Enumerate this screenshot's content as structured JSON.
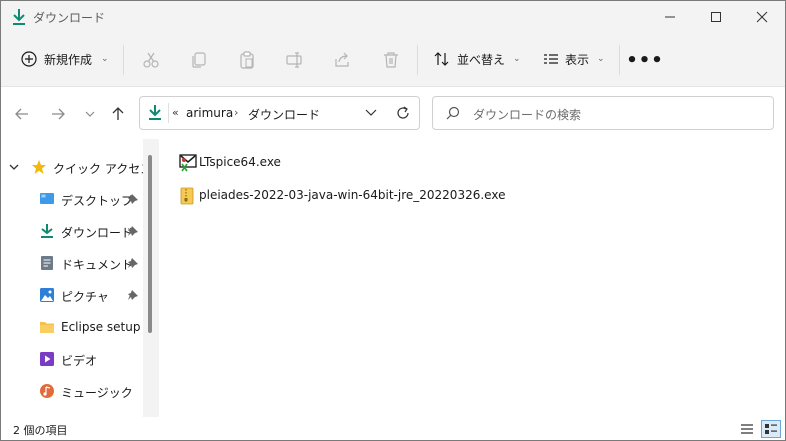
{
  "window": {
    "title": "ダウンロード",
    "title_icon": "download-arrow-icon",
    "controls": [
      "minimize-icon",
      "maximize-icon",
      "close-icon"
    ]
  },
  "toolbar": {
    "new_label": "新規作成",
    "actions": [
      "cut-icon",
      "copy-icon",
      "paste-icon",
      "rename-icon",
      "share-icon",
      "delete-icon"
    ],
    "sort_label": "並べ替え",
    "view_label": "表示",
    "more_label": "•••"
  },
  "nav": {
    "overflow": "«",
    "path": [
      "arimura",
      "ダウンロード"
    ],
    "path_separator": "›",
    "search_placeholder": "ダウンロードの検索"
  },
  "sidebar": {
    "quick_access_label": "クイック アクセス",
    "items": [
      {
        "label": "デスクトップ",
        "icon": "desktop-icon",
        "pinned": true
      },
      {
        "label": "ダウンロード",
        "icon": "download-icon",
        "pinned": true
      },
      {
        "label": "ドキュメント",
        "icon": "documents-icon",
        "pinned": true
      },
      {
        "label": "ピクチャ",
        "icon": "pictures-icon",
        "pinned": true
      },
      {
        "label": "Eclipse setup",
        "icon": "folder-icon",
        "pinned": false
      },
      {
        "label": "ビデオ",
        "icon": "videos-icon",
        "pinned": false
      },
      {
        "label": "ミュージック",
        "icon": "music-icon",
        "pinned": false
      }
    ]
  },
  "files": [
    {
      "name": "LTspice64.exe",
      "icon": "ltspice-exe-icon"
    },
    {
      "name": "pleiades-2022-03-java-win-64bit-jre_20220326.exe",
      "icon": "zip-exe-icon"
    }
  ],
  "status": {
    "item_count": "2 個の項目"
  },
  "colors": {
    "accent": "#0f8a72",
    "chrome_bg": "#f3f3f3",
    "star": "#f2b90c",
    "folder": "#f7c04a"
  }
}
